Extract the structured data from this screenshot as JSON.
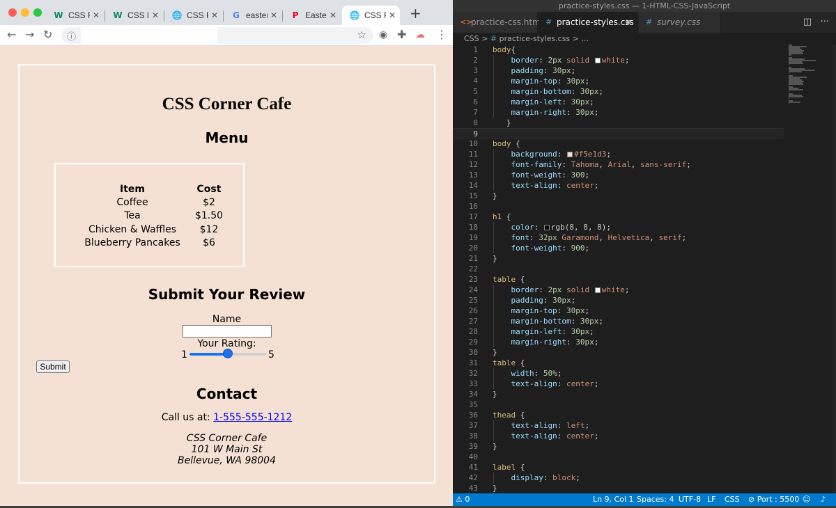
{
  "browser": {
    "tabs": [
      {
        "favicon": "w-icon",
        "glyph": "W",
        "color": "#0a8f5a",
        "title": "CSS Fo",
        "active": false
      },
      {
        "favicon": "w-icon",
        "glyph": "W",
        "color": "#0a8f5a",
        "title": "CSS le",
        "active": false
      },
      {
        "favicon": "globe-icon",
        "glyph": "🌐",
        "color": "#5f6368",
        "title": "CSS P",
        "active": false
      },
      {
        "favicon": "google-icon",
        "glyph": "G",
        "color": "#4285f4",
        "title": "easter",
        "active": false
      },
      {
        "favicon": "pinterest-icon",
        "glyph": "P",
        "color": "#e60023",
        "title": "Easter",
        "active": false
      },
      {
        "favicon": "globe-icon",
        "glyph": "🌐",
        "color": "#5f6368",
        "title": "CSS P",
        "active": true
      }
    ],
    "new_tab": "+",
    "close_glyph": "✕"
  },
  "page": {
    "title": "CSS Corner Cafe",
    "menu_heading": "Menu",
    "menu_table": {
      "headers": [
        "Item",
        "Cost"
      ],
      "rows": [
        [
          "Coffee",
          "$2"
        ],
        [
          "Tea",
          "$1.50"
        ],
        [
          "Chicken & Waffles",
          "$12"
        ],
        [
          "Blueberry Pancakes",
          "$6"
        ]
      ]
    },
    "review_heading": "Submit Your Review",
    "name_label": "Name",
    "rating_label": "Your Rating:",
    "rating_min": "1",
    "rating_max": "5",
    "rating_value": 3,
    "submit_label": "Submit",
    "contact_heading": "Contact",
    "call_prefix": "Call us at: ",
    "phone": "1-555-555-1212",
    "address": [
      "CSS Corner Cafe",
      "101 W Main St",
      "Bellevue, WA 98004"
    ]
  },
  "vscode": {
    "window_title": "practice-styles.css — 1-HTML-CSS-JavaScript",
    "tabs": [
      {
        "icon": "<>",
        "icon_color": "#e37933",
        "label": "practice-css.html",
        "active": false,
        "italic": false,
        "close": ""
      },
      {
        "icon": "#",
        "icon_color": "#519aba",
        "label": "practice-styles.css",
        "active": true,
        "italic": false,
        "close": "✕"
      },
      {
        "icon": "#",
        "icon_color": "#519aba",
        "label": "survey.css",
        "active": false,
        "italic": true,
        "close": ""
      }
    ],
    "breadcrumb": {
      "folder": "CSS",
      "sep": ">",
      "file": "practice-styles.css",
      "more": "> ..."
    },
    "status": {
      "problems": "⚠ 0",
      "position": "Ln 9, Col 1",
      "spaces": "Spaces: 4",
      "encoding": "UTF-8",
      "eol": "LF",
      "language": "CSS",
      "port": "⊘ Port : 5500"
    },
    "code_lines": [
      {
        "n": 1,
        "t": [
          [
            "sel",
            "body"
          ],
          [
            "",
            "{"
          ]
        ]
      },
      {
        "n": 2,
        "t": [
          [
            "prop",
            "    border"
          ],
          [
            "",
            ": "
          ],
          [
            "num",
            "2px"
          ],
          [
            "",
            " "
          ],
          [
            "val",
            "solid "
          ],
          [
            "sw",
            "#ffffff"
          ],
          [
            "val",
            "white"
          ],
          [
            "",
            ";"
          ]
        ]
      },
      {
        "n": 3,
        "t": [
          [
            "prop",
            "    padding"
          ],
          [
            "",
            ": "
          ],
          [
            "num",
            "30px"
          ],
          [
            "",
            ";"
          ]
        ]
      },
      {
        "n": 4,
        "t": [
          [
            "prop",
            "    margin-top"
          ],
          [
            "",
            ": "
          ],
          [
            "num",
            "30px"
          ],
          [
            "",
            ";"
          ]
        ]
      },
      {
        "n": 5,
        "t": [
          [
            "prop",
            "    margin-bottom"
          ],
          [
            "",
            ": "
          ],
          [
            "num",
            "30px"
          ],
          [
            "",
            ";"
          ]
        ]
      },
      {
        "n": 6,
        "t": [
          [
            "prop",
            "    margin-left"
          ],
          [
            "",
            ": "
          ],
          [
            "num",
            "30px"
          ],
          [
            "",
            ";"
          ]
        ]
      },
      {
        "n": 7,
        "t": [
          [
            "prop",
            "    margin-right"
          ],
          [
            "",
            ": "
          ],
          [
            "num",
            "30px"
          ],
          [
            "",
            ";"
          ]
        ]
      },
      {
        "n": 8,
        "t": [
          [
            "",
            "   }"
          ]
        ]
      },
      {
        "n": 9,
        "t": [],
        "current": true
      },
      {
        "n": 10,
        "t": [
          [
            "sel",
            "body"
          ],
          [
            "",
            " {"
          ]
        ]
      },
      {
        "n": 11,
        "t": [
          [
            "prop",
            "    background"
          ],
          [
            "",
            ": "
          ],
          [
            "sw",
            "#f5e1d3"
          ],
          [
            "val",
            "#f5e1d3"
          ],
          [
            "",
            ";"
          ]
        ]
      },
      {
        "n": 12,
        "t": [
          [
            "prop",
            "    font-family"
          ],
          [
            "",
            ": "
          ],
          [
            "val",
            "Tahoma"
          ],
          [
            "",
            ", "
          ],
          [
            "val",
            "Arial"
          ],
          [
            "",
            ", "
          ],
          [
            "val",
            "sans-serif"
          ],
          [
            "",
            ";"
          ]
        ]
      },
      {
        "n": 13,
        "t": [
          [
            "prop",
            "    font-weight"
          ],
          [
            "",
            ": "
          ],
          [
            "num",
            "300"
          ],
          [
            "",
            ";"
          ]
        ]
      },
      {
        "n": 14,
        "t": [
          [
            "prop",
            "    text-align"
          ],
          [
            "",
            ": "
          ],
          [
            "val",
            "center"
          ],
          [
            "",
            ";"
          ]
        ]
      },
      {
        "n": 15,
        "t": [
          [
            "",
            "}"
          ]
        ]
      },
      {
        "n": 16,
        "t": []
      },
      {
        "n": 17,
        "t": [
          [
            "sel",
            "h1"
          ],
          [
            "",
            " {"
          ]
        ]
      },
      {
        "n": 18,
        "t": [
          [
            "prop",
            "    color"
          ],
          [
            "",
            ": "
          ],
          [
            "sw",
            "#080808"
          ],
          [
            "",
            "rgb("
          ],
          [
            "num",
            "8"
          ],
          [
            "",
            ", "
          ],
          [
            "num",
            "8"
          ],
          [
            "",
            ", "
          ],
          [
            "num",
            "8"
          ],
          [
            "",
            ");"
          ]
        ]
      },
      {
        "n": 19,
        "t": [
          [
            "prop",
            "    font"
          ],
          [
            "",
            ": "
          ],
          [
            "num",
            "32px"
          ],
          [
            "",
            " "
          ],
          [
            "val",
            "Garamond"
          ],
          [
            "",
            ", "
          ],
          [
            "val",
            "Helvetica"
          ],
          [
            "",
            ", "
          ],
          [
            "val",
            "serif"
          ],
          [
            "",
            ";"
          ]
        ]
      },
      {
        "n": 20,
        "t": [
          [
            "prop",
            "    font-weight"
          ],
          [
            "",
            ": "
          ],
          [
            "num",
            "900"
          ],
          [
            "",
            ";"
          ]
        ]
      },
      {
        "n": 21,
        "t": [
          [
            "",
            "}"
          ]
        ]
      },
      {
        "n": 22,
        "t": []
      },
      {
        "n": 23,
        "t": [
          [
            "sel",
            "table"
          ],
          [
            "",
            " {"
          ]
        ]
      },
      {
        "n": 24,
        "t": [
          [
            "prop",
            "    border"
          ],
          [
            "",
            ": "
          ],
          [
            "num",
            "2px"
          ],
          [
            "",
            " "
          ],
          [
            "val",
            "solid "
          ],
          [
            "sw",
            "#ffffff"
          ],
          [
            "val",
            "white"
          ],
          [
            "",
            ";"
          ]
        ]
      },
      {
        "n": 25,
        "t": [
          [
            "prop",
            "    padding"
          ],
          [
            "",
            ": "
          ],
          [
            "num",
            "30px"
          ],
          [
            "",
            ";"
          ]
        ]
      },
      {
        "n": 26,
        "t": [
          [
            "prop",
            "    margin-top"
          ],
          [
            "",
            ": "
          ],
          [
            "num",
            "30px"
          ],
          [
            "",
            ";"
          ]
        ]
      },
      {
        "n": 27,
        "t": [
          [
            "prop",
            "    margin-bottom"
          ],
          [
            "",
            ": "
          ],
          [
            "num",
            "30px"
          ],
          [
            "",
            ";"
          ]
        ]
      },
      {
        "n": 28,
        "t": [
          [
            "prop",
            "    margin-left"
          ],
          [
            "",
            ": "
          ],
          [
            "num",
            "30px"
          ],
          [
            "",
            ";"
          ]
        ]
      },
      {
        "n": 29,
        "t": [
          [
            "prop",
            "    margin-right"
          ],
          [
            "",
            ": "
          ],
          [
            "num",
            "30px"
          ],
          [
            "",
            ";"
          ]
        ]
      },
      {
        "n": 30,
        "t": [
          [
            "",
            "}"
          ]
        ]
      },
      {
        "n": 31,
        "t": [
          [
            "sel",
            "table"
          ],
          [
            "",
            " {"
          ]
        ]
      },
      {
        "n": 32,
        "t": [
          [
            "prop",
            "    width"
          ],
          [
            "",
            ": "
          ],
          [
            "num",
            "50%"
          ],
          [
            "",
            ";"
          ]
        ]
      },
      {
        "n": 33,
        "t": [
          [
            "prop",
            "    text-align"
          ],
          [
            "",
            ": "
          ],
          [
            "val",
            "center"
          ],
          [
            "",
            ";"
          ]
        ]
      },
      {
        "n": 34,
        "t": [
          [
            "",
            "}"
          ]
        ]
      },
      {
        "n": 35,
        "t": []
      },
      {
        "n": 36,
        "t": [
          [
            "sel",
            "thead"
          ],
          [
            "",
            " {"
          ]
        ]
      },
      {
        "n": 37,
        "t": [
          [
            "prop",
            "    text-align"
          ],
          [
            "",
            ": "
          ],
          [
            "val",
            "left"
          ],
          [
            "",
            ";"
          ]
        ]
      },
      {
        "n": 38,
        "t": [
          [
            "prop",
            "    text-align"
          ],
          [
            "",
            ": "
          ],
          [
            "val",
            "center"
          ],
          [
            "",
            ";"
          ]
        ]
      },
      {
        "n": 39,
        "t": [
          [
            "",
            "}"
          ]
        ]
      },
      {
        "n": 40,
        "t": []
      },
      {
        "n": 41,
        "t": [
          [
            "sel",
            "label"
          ],
          [
            "",
            " {"
          ]
        ]
      },
      {
        "n": 42,
        "t": [
          [
            "prop",
            "    display"
          ],
          [
            "",
            ": "
          ],
          [
            "val",
            "block"
          ],
          [
            "",
            ";"
          ]
        ]
      },
      {
        "n": 43,
        "t": [
          [
            "",
            "}"
          ]
        ]
      }
    ]
  },
  "colors": {
    "page_bg": "#f5e1d3",
    "editor_bg": "#1e1e1e",
    "statusbar": "#007acc",
    "link": "#0000ee",
    "slider": "#1a73e8"
  }
}
